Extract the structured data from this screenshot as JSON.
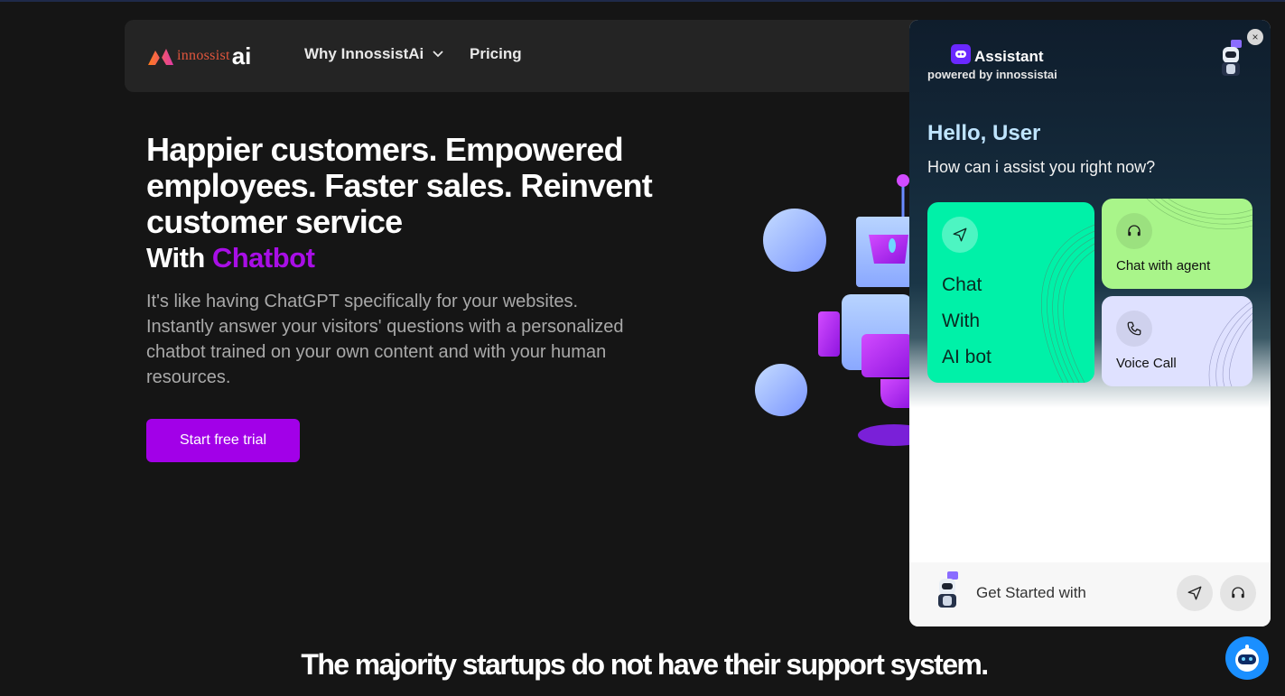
{
  "nav": {
    "logo_text": "innossist",
    "logo_ai": "ai",
    "why_label": "Why InnossistAi",
    "pricing_label": "Pricing"
  },
  "hero": {
    "title": "Happier customers. Empowered employees. Faster sales. Reinvent customer service",
    "with_label": "With",
    "accent_label": "Chatbot",
    "description": "It's like having ChatGPT specifically for your websites. Instantly answer your visitors' questions with a personalized chatbot trained on your own content and with your human resources.",
    "cta_label": "Start free trial"
  },
  "bottom_heading": "The majority startups do not have their support system.",
  "widget": {
    "title": "Assistant",
    "powered": "powered by innossistai",
    "close_label": "×",
    "hello": "Hello, User",
    "subtitle": "How can i assist you right now?",
    "cards": {
      "chat_line1": "Chat",
      "chat_line2": "With",
      "chat_line3": "AI bot",
      "agent_label": "Chat with agent",
      "voice_label": "Voice Call"
    },
    "footer": {
      "input_placeholder": "Get Started with"
    }
  },
  "colors": {
    "accent_purple": "#a200e8",
    "chat_card": "#00f1a8",
    "agent_card": "#a9f58a",
    "voice_card": "#dfe1ff",
    "hello_text": "#bfe5ff"
  },
  "icons": [
    "chevron-down-icon",
    "send-icon",
    "headset-icon",
    "phone-icon",
    "robot-avatar-icon",
    "discord-like-bot-icon"
  ]
}
